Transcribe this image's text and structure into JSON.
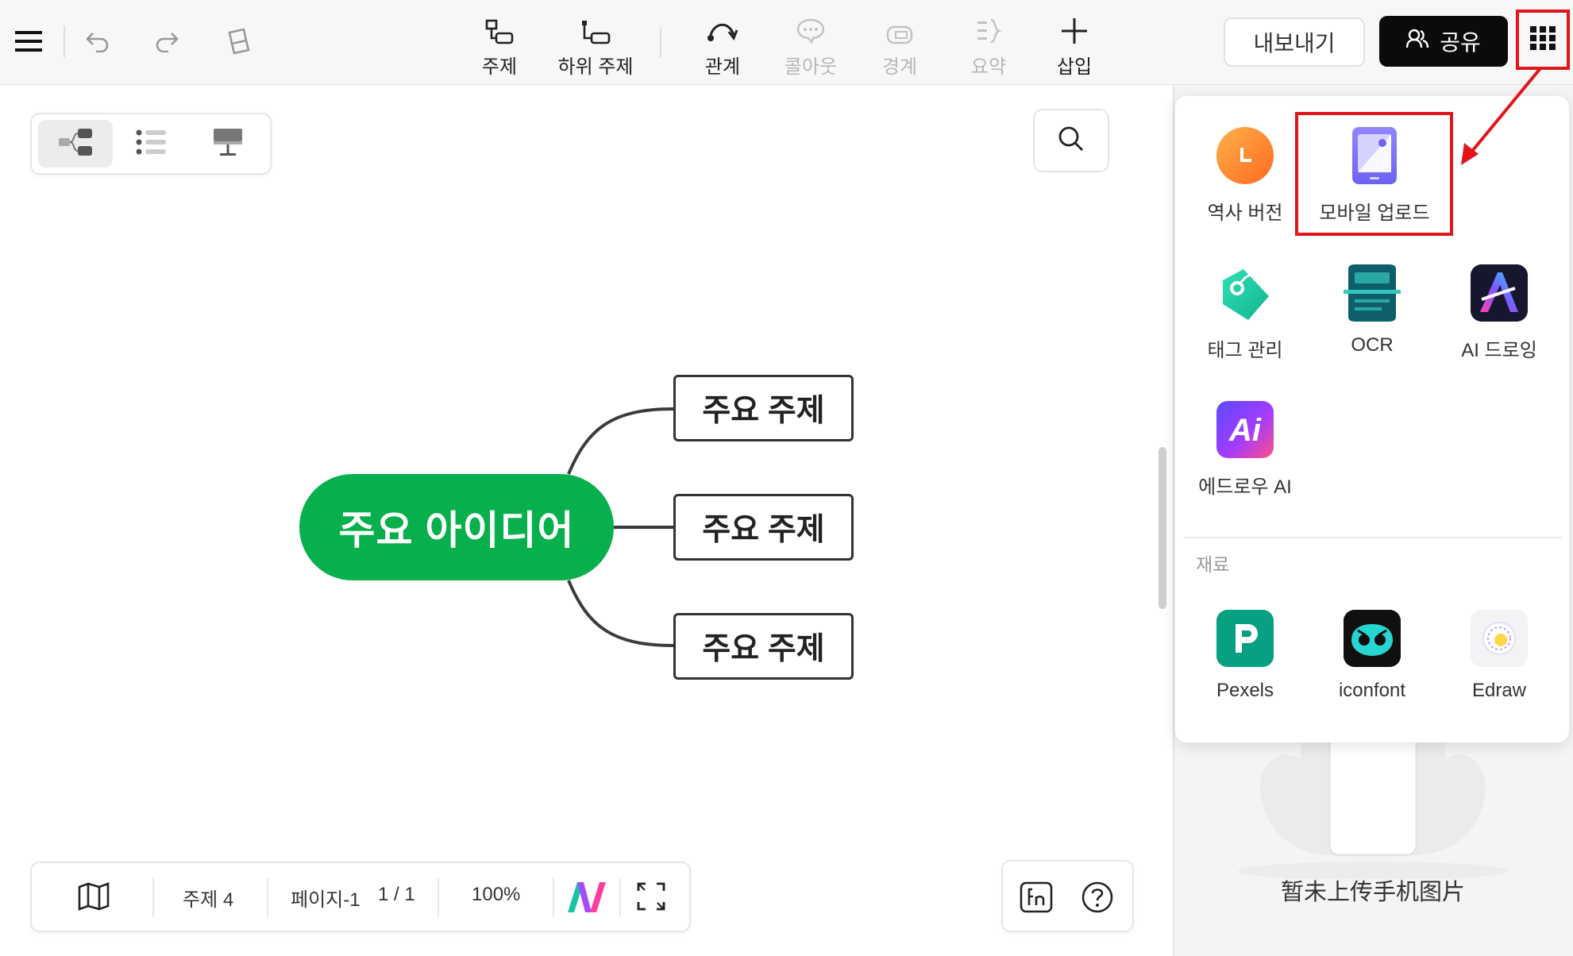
{
  "toolbar": {
    "tools": [
      {
        "label": "주제",
        "icon": "topic-icon",
        "enabled": true
      },
      {
        "label": "하위 주제",
        "icon": "subtopic-icon",
        "enabled": true
      },
      {
        "label": "관계",
        "icon": "relationship-icon",
        "enabled": true
      },
      {
        "label": "콜아웃",
        "icon": "callout-icon",
        "enabled": false
      },
      {
        "label": "경계",
        "icon": "boundary-icon",
        "enabled": false
      },
      {
        "label": "요약",
        "icon": "summary-icon",
        "enabled": false
      },
      {
        "label": "삽입",
        "icon": "plus-icon",
        "enabled": true
      }
    ],
    "export_label": "내보내기",
    "share_label": "공유"
  },
  "mindmap": {
    "central": "주요 아이디어",
    "topics": [
      "주요 주제",
      "주요 주제",
      "주요 주제"
    ],
    "central_color": "#07b04c"
  },
  "bottombar": {
    "topic_count": "주제 4",
    "page_name": "페이지-1",
    "page_number": "1 / 1",
    "zoom": "100%"
  },
  "apps_panel": {
    "apps": [
      {
        "name": "역사 버전",
        "icon": "history-icon"
      },
      {
        "name": "모바일 업로드",
        "icon": "mobile-upload-icon"
      },
      {
        "name": "태그 관리",
        "icon": "tag-icon"
      },
      {
        "name": "OCR",
        "icon": "ocr-icon"
      },
      {
        "name": "AI 드로잉",
        "icon": "ai-drawing-icon"
      },
      {
        "name": "에드로우 AI",
        "icon": "edraw-ai-icon"
      }
    ],
    "materials_label": "재료",
    "materials": [
      {
        "name": "Pexels",
        "icon": "pexels-icon"
      },
      {
        "name": "iconfont",
        "icon": "iconfont-icon"
      },
      {
        "name": "Edraw",
        "icon": "edraw-icon"
      }
    ]
  },
  "mobile_upload": {
    "empty_message": "暂未上传手机图片"
  },
  "colors": {
    "accent_green": "#07b04c",
    "highlight_red": "#e0161a",
    "share_button": "#0b0b0b"
  }
}
